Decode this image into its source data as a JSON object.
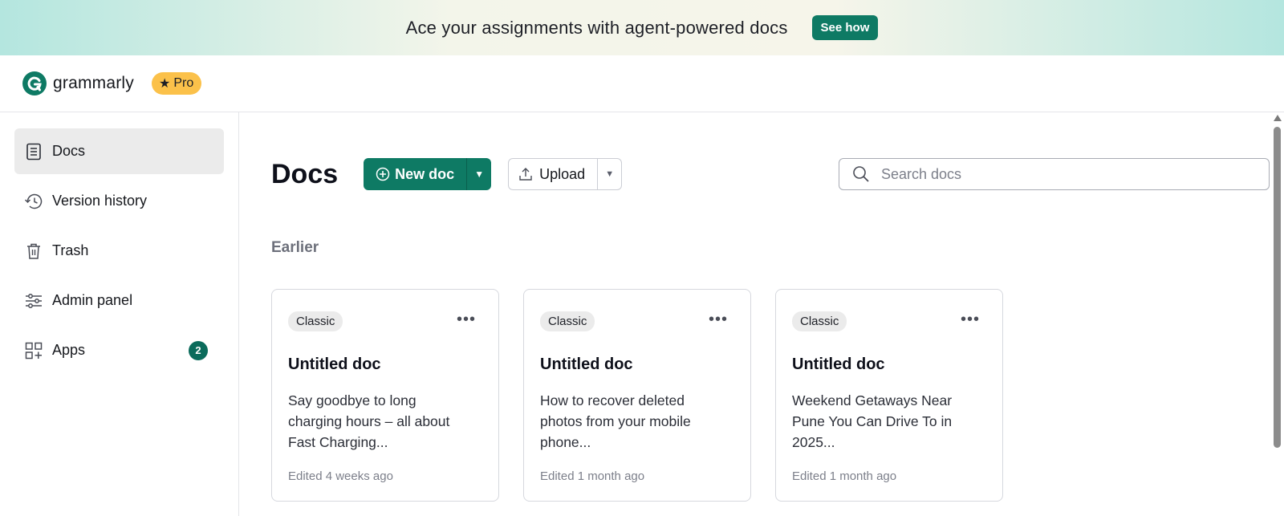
{
  "banner": {
    "text": "Ace your assignments with agent-powered docs",
    "button_label": "See how"
  },
  "header": {
    "logo_text": "grammarly",
    "badge_label": "Pro",
    "brand_color": "#0e7a64",
    "badge_color": "#fbc14a"
  },
  "sidebar": {
    "items": [
      {
        "label": "Docs",
        "icon": "document-icon",
        "active": true
      },
      {
        "label": "Version history",
        "icon": "history-icon"
      },
      {
        "label": "Trash",
        "icon": "trash-icon"
      },
      {
        "label": "Admin panel",
        "icon": "sliders-icon"
      },
      {
        "label": "Apps",
        "icon": "apps-icon",
        "badge": "2"
      }
    ]
  },
  "main": {
    "title": "Docs",
    "new_doc_label": "New doc",
    "upload_label": "Upload",
    "search_placeholder": "Search docs",
    "section_label": "Earlier",
    "cards": [
      {
        "tag": "Classic",
        "title": "Untitled doc",
        "description": "Say goodbye to long charging hours – all about Fast Charging...",
        "meta": "Edited 4 weeks ago"
      },
      {
        "tag": "Classic",
        "title": "Untitled doc",
        "description": "How to recover deleted photos from your mobile phone...",
        "meta": "Edited 1 month ago"
      },
      {
        "tag": "Classic",
        "title": "Untitled doc",
        "description": "Weekend Getaways Near Pune You Can Drive To in 2025...",
        "meta": "Edited 1 month ago"
      }
    ]
  }
}
